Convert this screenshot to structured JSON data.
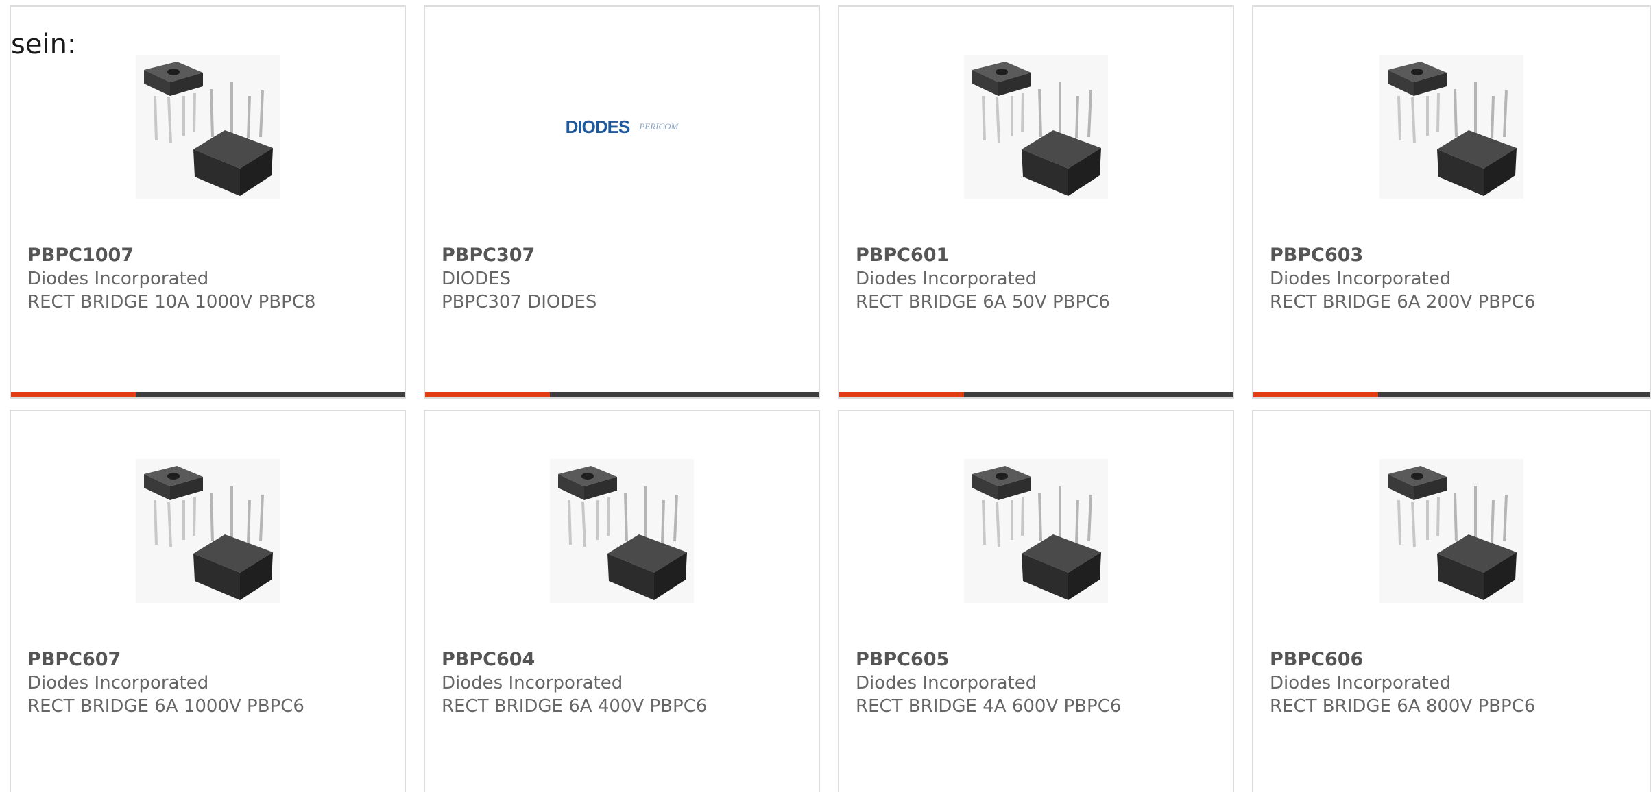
{
  "intro_text": "sein:",
  "colors": {
    "accent": "#e23c14",
    "bar": "#3d3d3d",
    "border": "#dcdcdc",
    "text": "#666666"
  },
  "products": [
    {
      "part_number": "PBPC1007",
      "manufacturer": "Diodes Incorporated",
      "description": "RECT BRIDGE 10A 1000V PBPC8",
      "image": "bridge-rectifier-image"
    },
    {
      "part_number": "PBPC307",
      "manufacturer": "DIODES",
      "description": "PBPC307 DIODES",
      "image": "diodes-pericom-logo",
      "logo": {
        "main": "DIODES",
        "sub": "PERICOM"
      }
    },
    {
      "part_number": "PBPC601",
      "manufacturer": "Diodes Incorporated",
      "description": "RECT BRIDGE 6A 50V PBPC6",
      "image": "bridge-rectifier-image"
    },
    {
      "part_number": "PBPC603",
      "manufacturer": "Diodes Incorporated",
      "description": "RECT BRIDGE 6A 200V PBPC6",
      "image": "bridge-rectifier-image"
    },
    {
      "part_number": "PBPC607",
      "manufacturer": "Diodes Incorporated",
      "description": "RECT BRIDGE 6A 1000V PBPC6",
      "image": "bridge-rectifier-image"
    },
    {
      "part_number": "PBPC604",
      "manufacturer": "Diodes Incorporated",
      "description": "RECT BRIDGE 6A 400V PBPC6",
      "image": "bridge-rectifier-image"
    },
    {
      "part_number": "PBPC605",
      "manufacturer": "Diodes Incorporated",
      "description": "RECT BRIDGE 4A 600V PBPC6",
      "image": "bridge-rectifier-image"
    },
    {
      "part_number": "PBPC606",
      "manufacturer": "Diodes Incorporated",
      "description": "RECT BRIDGE 6A 800V PBPC6",
      "image": "bridge-rectifier-image"
    }
  ]
}
